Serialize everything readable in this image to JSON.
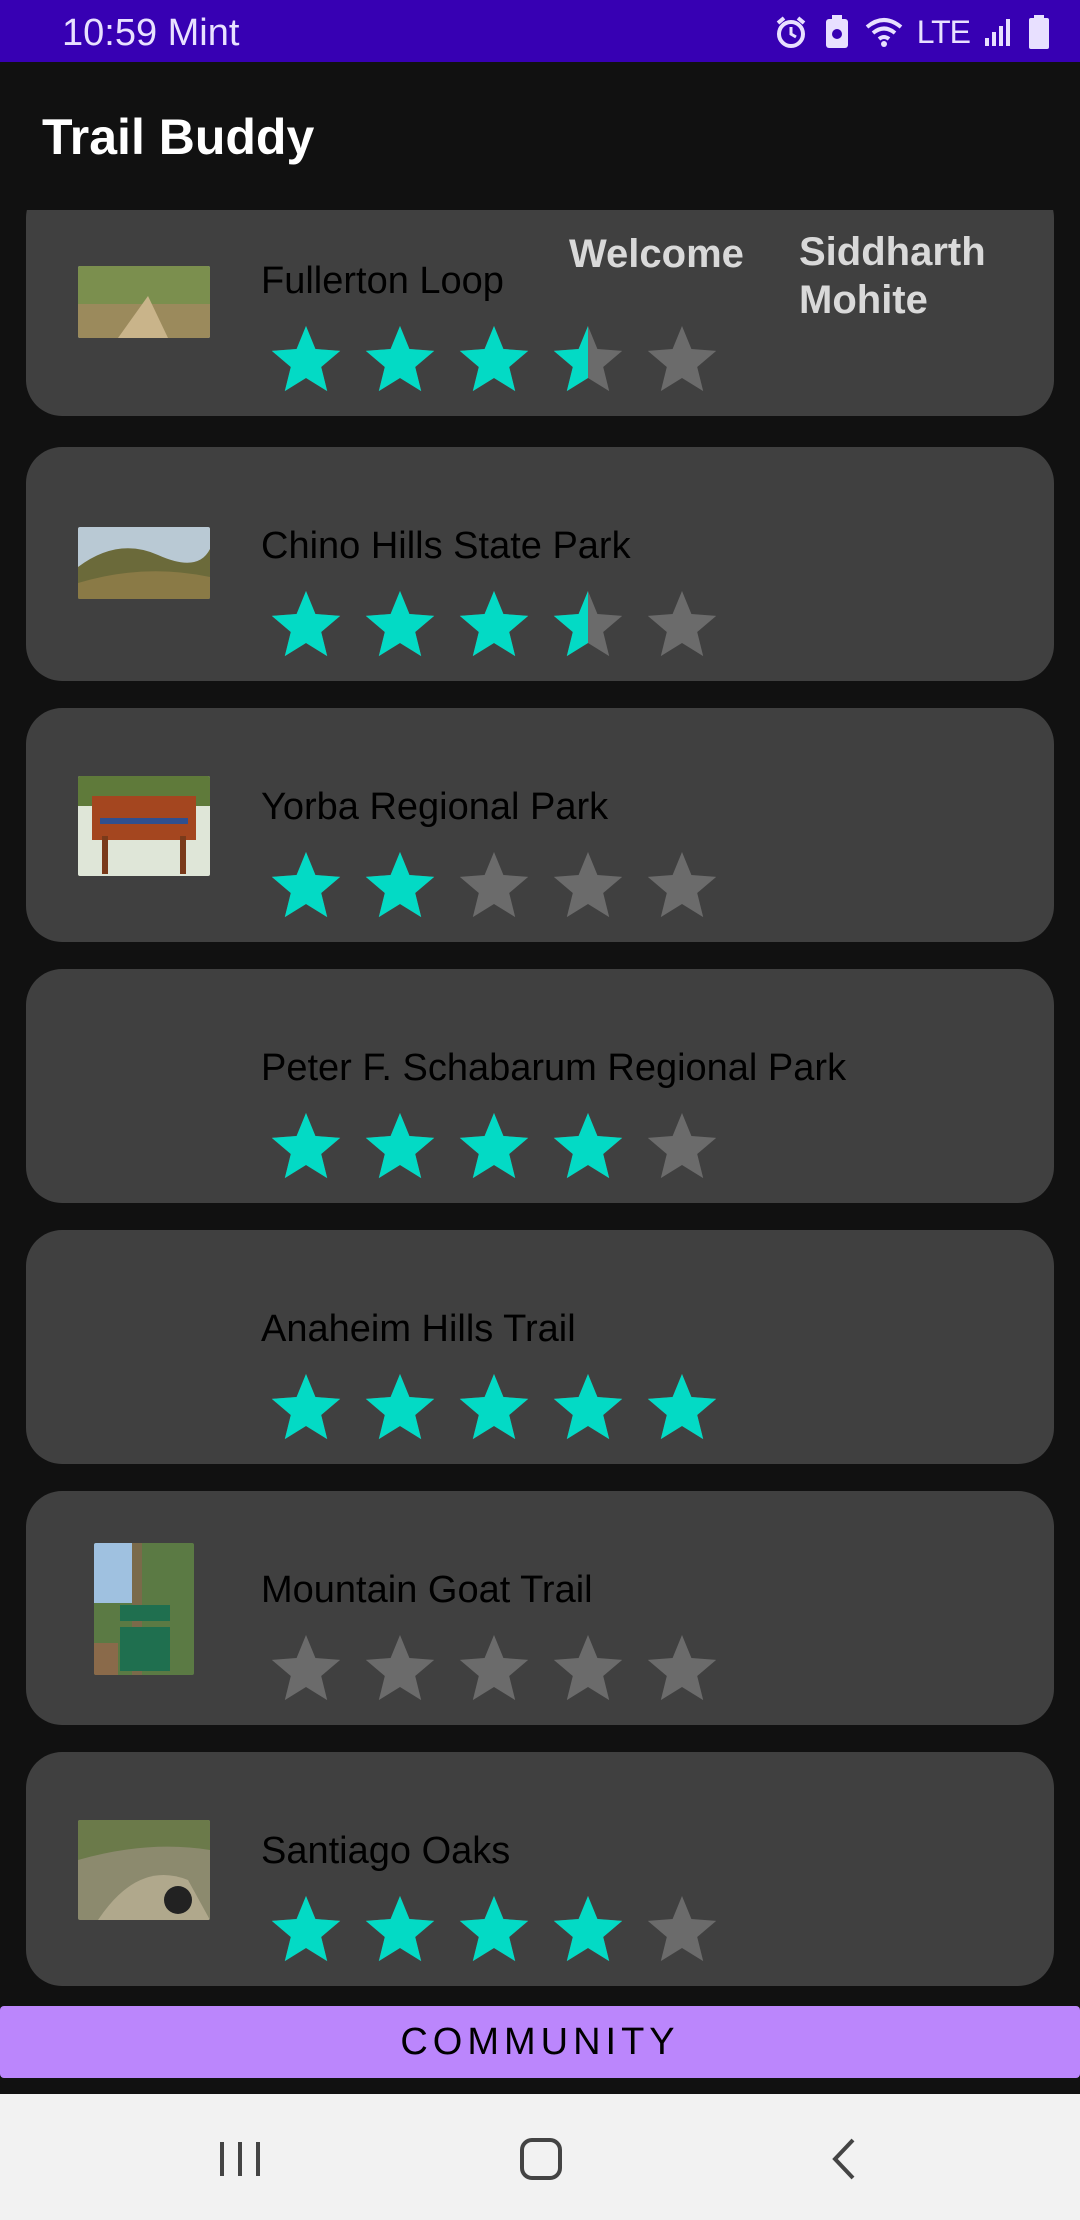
{
  "status_bar": {
    "time": "10:59",
    "carrier": "Mint",
    "network": "LTE",
    "icons": [
      "alarm-icon",
      "battery-saver-icon",
      "wifi-icon",
      "signal-icon",
      "battery-icon"
    ]
  },
  "app": {
    "title": "Trail Buddy"
  },
  "header_overlay": {
    "welcome": "Welcome",
    "user_name": "Siddharth Mohite"
  },
  "colors": {
    "star_filled": "#03dac5",
    "star_empty": "#6b6b6b",
    "card": "#404040",
    "accent": "#bb86fc",
    "status_bar": "#3700b3"
  },
  "trails": [
    {
      "name": "Fullerton Loop",
      "rating": 3.5,
      "image": "trail-photo"
    },
    {
      "name": "Chino Hills State Park",
      "rating": 3.5,
      "image": "trail-photo"
    },
    {
      "name": "Yorba Regional Park",
      "rating": 2,
      "image": "sign-photo"
    },
    {
      "name": "Peter F. Schabarum Regional Park",
      "rating": 4,
      "image": ""
    },
    {
      "name": "Anaheim Hills Trail",
      "rating": 5,
      "image": ""
    },
    {
      "name": "Mountain Goat Trail",
      "rating": 0,
      "image": "sign-photo"
    },
    {
      "name": "Santiago Oaks",
      "rating": 4,
      "image": "trail-photo"
    }
  ],
  "rating_max": 5,
  "community_button": {
    "label": "COMMUNITY"
  },
  "nav_bar": {
    "buttons": [
      "recents-icon",
      "home-icon",
      "back-icon"
    ]
  }
}
